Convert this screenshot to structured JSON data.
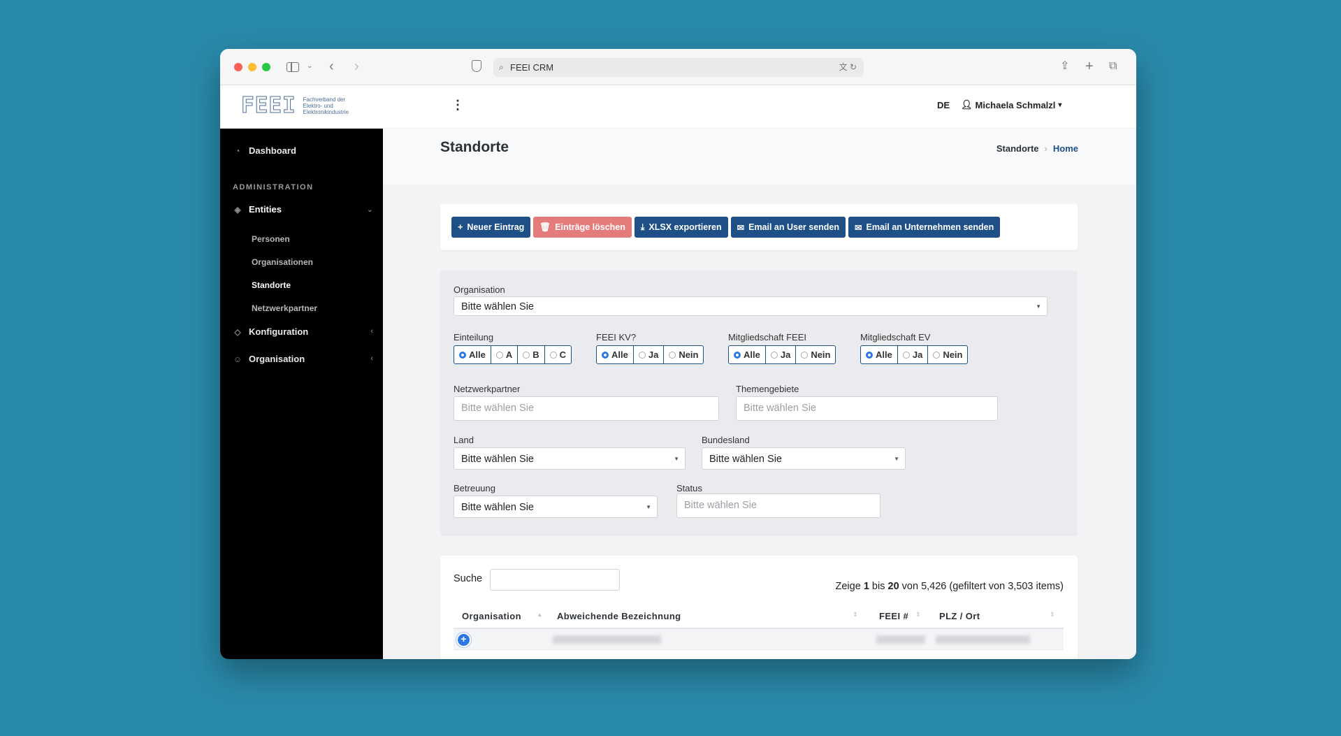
{
  "browser": {
    "url": "FEEI CRM",
    "colors": {
      "red": "#fe5f57",
      "yellow": "#febc2e",
      "green": "#28c840"
    }
  },
  "header": {
    "logo_mark": "FEEI",
    "logo_text": "Fachverband der Elektro- und Elektronikindustrie",
    "language": "DE",
    "user": "Michaela Schmalzl"
  },
  "sidebar": {
    "dashboard": "Dashboard",
    "section": "ADMINISTRATION",
    "entities": "Entities",
    "sub_items": [
      "Personen",
      "Organisationen",
      "Standorte",
      "Netzwerkpartner"
    ],
    "konfiguration": "Konfiguration",
    "organisation": "Organisation"
  },
  "page": {
    "title": "Standorte",
    "breadcrumb_current": "Standorte",
    "breadcrumb_home": "Home"
  },
  "actions": {
    "new": "Neuer Eintrag",
    "delete": "Einträge löschen",
    "export": "XLSX exportieren",
    "email_user": "Email an User senden",
    "email_company": "Email an Unternehmen senden",
    "colors": {
      "primary": "#1e4f86",
      "danger": "#e57c7c"
    }
  },
  "filters": {
    "organisation_label": "Organisation",
    "placeholder": "Bitte wählen Sie",
    "einteilung": {
      "label": "Einteilung",
      "options": [
        "Alle",
        "A",
        "B",
        "C"
      ],
      "selected": "Alle"
    },
    "kv": {
      "label": "FEEI KV?",
      "options": [
        "Alle",
        "Ja",
        "Nein"
      ],
      "selected": "Alle"
    },
    "mitglied_feei": {
      "label": "Mitgliedschaft FEEI",
      "options": [
        "Alle",
        "Ja",
        "Nein"
      ],
      "selected": "Alle"
    },
    "mitglied_ev": {
      "label": "Mitgliedschaft EV",
      "options": [
        "Alle",
        "Ja",
        "Nein"
      ],
      "selected": "Alle"
    },
    "netzwerkpartner_label": "Netzwerkpartner",
    "themengebiete_label": "Themengebiete",
    "land_label": "Land",
    "bundesland_label": "Bundesland",
    "betreuung_label": "Betreuung",
    "status_label": "Status"
  },
  "table": {
    "search_label": "Suche",
    "info_prefix": "Zeige ",
    "info_from": "1",
    "info_mid": " bis ",
    "info_to": "20",
    "info_suffix": " von 5,426 (gefiltert von 3,503 items)",
    "columns": [
      "Organisation",
      "Abweichende Bezeichnung",
      "FEEI #",
      "PLZ / Ort"
    ]
  }
}
